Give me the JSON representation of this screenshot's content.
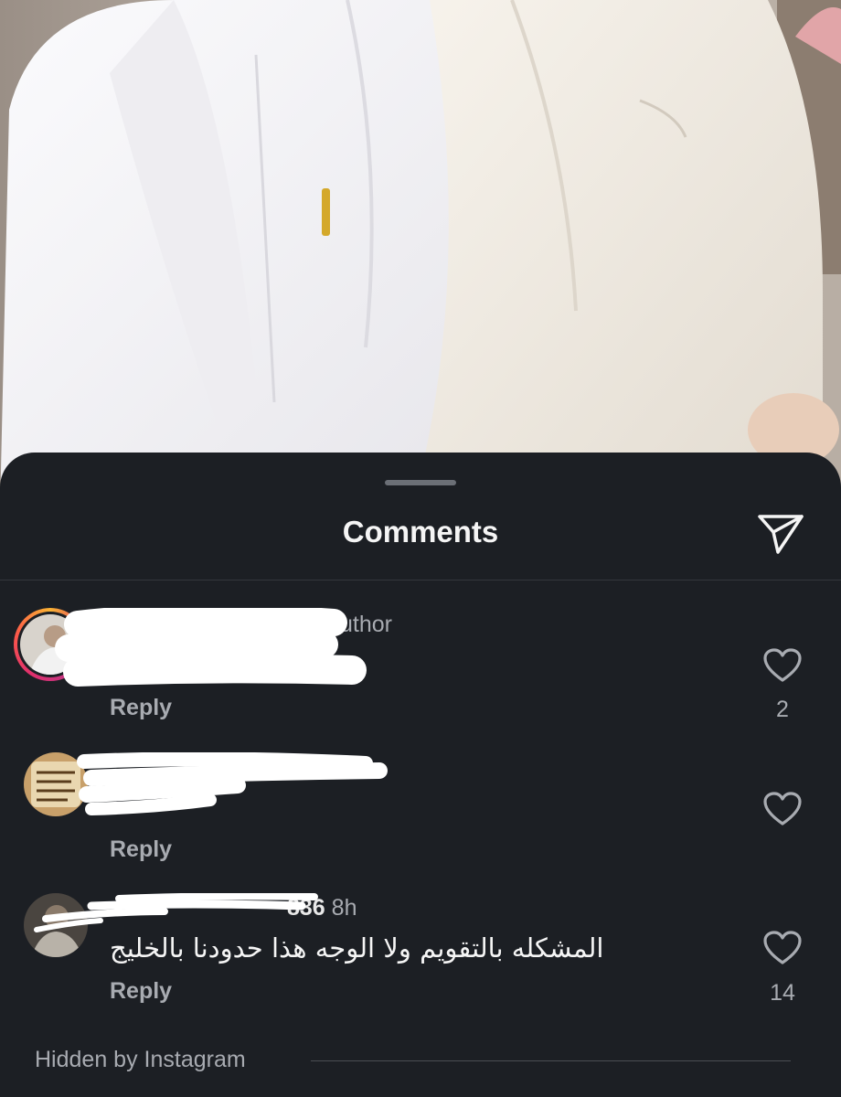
{
  "sheet": {
    "title": "Comments",
    "share_icon": "send-icon"
  },
  "comments": [
    {
      "username": "",
      "badge": "uthor",
      "time": "",
      "text": "",
      "reply_label": "Reply",
      "like_count": "2",
      "redacted": true
    },
    {
      "username": "",
      "badge": "",
      "time": "",
      "text": "",
      "reply_label": "Reply",
      "like_count": "",
      "redacted": true
    },
    {
      "username": "836",
      "badge": "",
      "time": "8h",
      "text": "المشكله بالتقويم ولا الوجه هذا حدودنا بالخليج",
      "reply_label": "Reply",
      "like_count": "14",
      "redacted": true
    }
  ],
  "hidden_notice": "Hidden by Instagram",
  "colors": {
    "sheet_bg": "#1c1f24",
    "text_primary": "#f5f5f5",
    "text_secondary": "#a8abb1",
    "divider": "#34373d"
  }
}
